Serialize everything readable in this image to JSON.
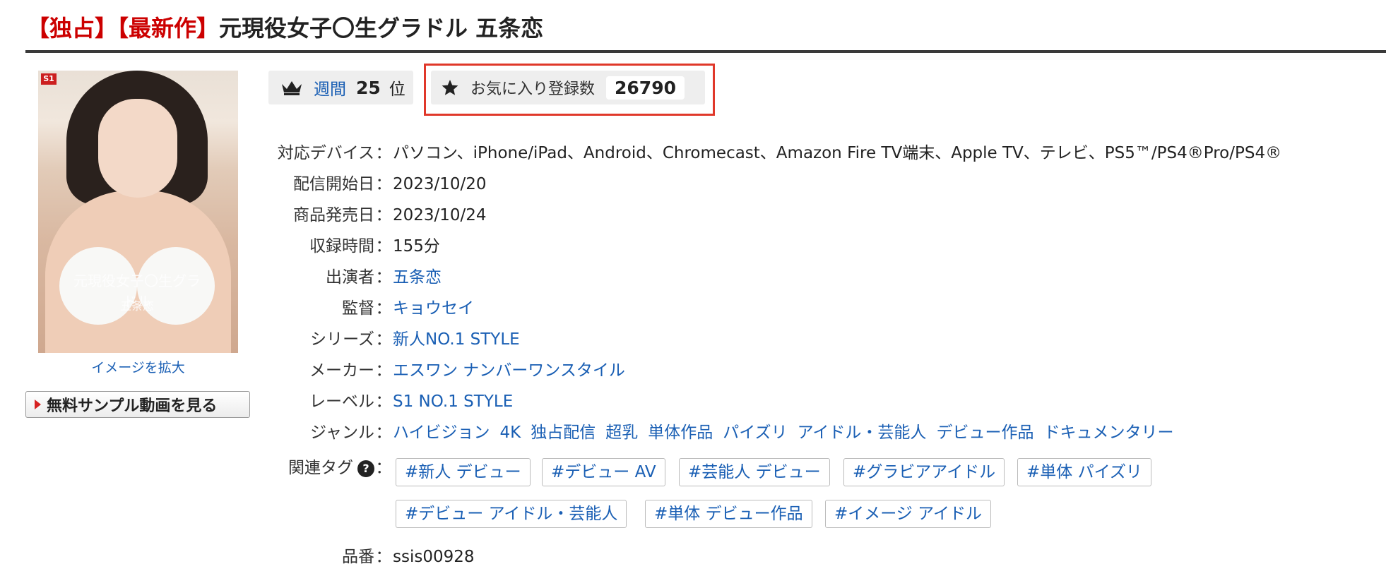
{
  "title": {
    "badge_exclusive": "【独占】",
    "badge_newest": "【最新作】",
    "text": "元現役女子〇生グラドル 五条恋"
  },
  "package": {
    "cover_title": "元現役女子〇生グラドル",
    "cover_name": "五条恋",
    "logo": "S1",
    "enlarge_label": "イメージを拡大"
  },
  "sample_button": "無料サンプル動画を見る",
  "ranking": {
    "period": "週間",
    "rank": "25",
    "unit": "位",
    "icon": "crown-icon"
  },
  "favorites": {
    "label": "お気に入り登録数",
    "count": "26790",
    "icon": "star-icon",
    "highlight_color": "#e0382a"
  },
  "details": {
    "devices": {
      "label": "対応デバイス",
      "value": "パソコン、iPhone/iPad、Android、Chromecast、Amazon Fire TV端末、Apple TV、テレビ、PS5™/PS4®Pro/PS4®"
    },
    "delivery_date": {
      "label": "配信開始日",
      "value": "2023/10/20"
    },
    "release_date": {
      "label": "商品発売日",
      "value": "2023/10/24"
    },
    "duration": {
      "label": "収録時間",
      "value": "155分"
    },
    "performer": {
      "label": "出演者",
      "value": "五条恋"
    },
    "director": {
      "label": "監督",
      "value": "キョウセイ"
    },
    "series": {
      "label": "シリーズ",
      "value": "新人NO.1 STYLE"
    },
    "maker": {
      "label": "メーカー",
      "value": "エスワン ナンバーワンスタイル"
    },
    "label_name": {
      "label": "レーベル",
      "value": "S1 NO.1 STYLE"
    },
    "genre": {
      "label": "ジャンル",
      "items": [
        "ハイビジョン",
        "4K",
        "独占配信",
        "超乳",
        "単体作品",
        "パイズリ",
        "アイドル・芸能人",
        "デビュー作品",
        "ドキュメンタリー"
      ]
    },
    "tags": {
      "label": "関連タグ",
      "items": [
        "#新人 デビュー",
        "#デビュー AV",
        "#芸能人 デビュー",
        "#グラビアアイドル",
        "#単体 パイズリ",
        "#デビュー アイドル・芸能人",
        "#単体 デビュー作品",
        "#イメージ アイドル"
      ]
    },
    "product_id": {
      "label": "品番",
      "value": "ssis00928"
    },
    "separator": "："
  },
  "colors": {
    "link": "#1a5fb4",
    "badge_red": "#cc0000",
    "rule": "#3a3a3a"
  }
}
